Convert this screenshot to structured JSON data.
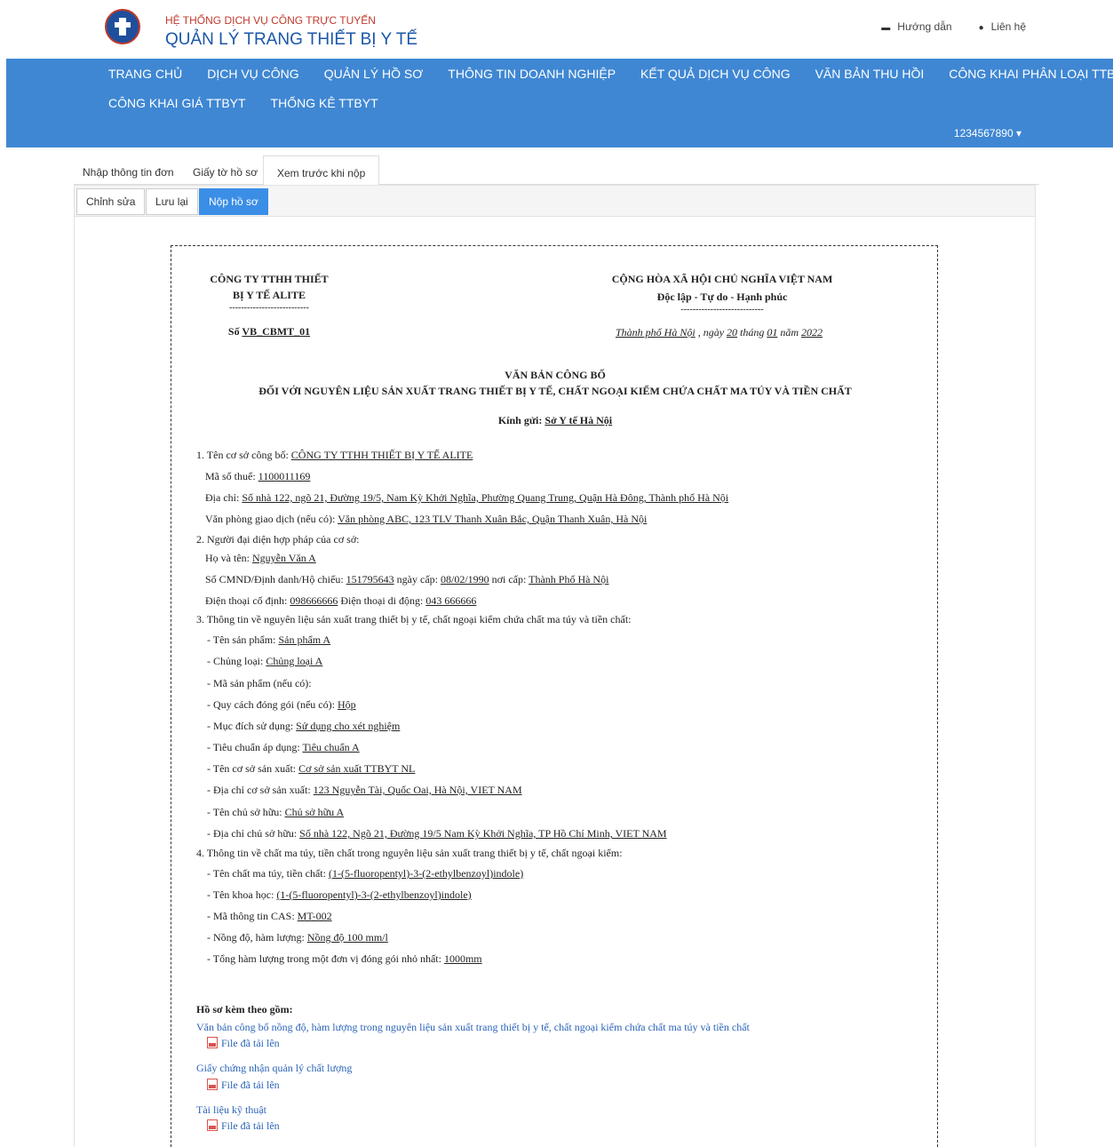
{
  "header": {
    "system": "HỆ THỐNG DỊCH VỤ CÔNG TRỰC TUYẾN",
    "title": "QUẢN LÝ TRANG THIẾT BỊ Y TẾ",
    "guide": "Hướng dẫn",
    "contact": "Liên hệ"
  },
  "nav": {
    "row1": [
      "TRANG CHỦ",
      "DỊCH VỤ CÔNG",
      "QUẢN LÝ HỒ SƠ",
      "THÔNG TIN DOANH NGHIỆP",
      "KẾT QUẢ DỊCH VỤ CÔNG",
      "VĂN BẢN THU HỒI",
      "CÔNG KHAI PHÂN LOẠI TTBYT"
    ],
    "row2": [
      "CÔNG KHAI GIÁ TTBYT",
      "THỐNG KÊ TTBYT"
    ],
    "user": "1234567890 ▾"
  },
  "tabs": [
    "Nhập thông tin đơn",
    "Giấy tờ hồ sơ",
    "Xem trước khi nộp"
  ],
  "toolbar": {
    "edit": "Chỉnh sửa",
    "save": "Lưu lại",
    "submit": "Nộp hồ sơ"
  },
  "doc": {
    "company1": "CÔNG TY TTHH THIẾT",
    "company2": "BỊ Y TẾ ALITE",
    "dash_left": "---------------------------",
    "number_prefix": "Số",
    "number": "VB_CBMT_01",
    "nation": "CỘNG HÒA XÃ HỘI CHỦ NGHĨA VIỆT NAM",
    "motto": "Độc lập - Tự do - Hạnh phúc",
    "dash_right": "----------------------------",
    "date_place": "Thành phố Hà Nội",
    "date_rest": " , ngày ",
    "day": "20",
    "month_label": " tháng ",
    "month": "01",
    "year_label": " năm ",
    "year": "2022",
    "title1": "VĂN BẢN CÔNG BỐ",
    "title2": "ĐỐI VỚI NGUYÊN LIỆU SẢN XUẤT TRANG THIẾT BỊ Y TẾ, CHẤT NGOẠI KIỂM CHỨA CHẤT MA TÚY VÀ TIỀN CHẤT",
    "kinh_gui_label": "Kính gửi: ",
    "kinh_gui": "Sở Y tế Hà Nội",
    "lines": [
      {
        "label": "1. Tên cơ sở công bố: ",
        "value": "CÔNG TY TTHH THIẾT BỊ Y TẾ ALITE",
        "indent": 0
      },
      {
        "label": "Mã số thuế: ",
        "value": "1100011169",
        "indent": 1
      },
      {
        "label": "Địa chỉ: ",
        "value": "Số nhà 122, ngõ 21, Đường 19/5, Nam Kỳ Khởi Nghĩa, Phường Quang Trung, Quận Hà Đông, Thành phố Hà Nội",
        "indent": 1
      },
      {
        "label": "Văn phòng giao dịch (nếu có): ",
        "value": "Văn phòng ABC, 123 TLV Thanh Xuân Bắc, Quận Thanh Xuân, Hà Nội",
        "indent": 1
      },
      {
        "label": "2. Người đại diện hợp pháp của cơ sở:",
        "value": "",
        "indent": 0
      },
      {
        "label": "Họ và tên: ",
        "value": "Nguyễn Văn A",
        "indent": 1
      },
      {
        "label": "Số CMND/Định danh/Hộ chiếu: ",
        "value": "151795643",
        "label2": "  ngày cấp: ",
        "value2": "08/02/1990",
        "label3": "  nơi cấp: ",
        "value3": "Thành Phố Hà Nội",
        "indent": 1
      },
      {
        "label": "Điện thoại cố định: ",
        "value": "098666666",
        "label2": "  Điện thoại di động: ",
        "value2": "043 666666",
        "indent": 1
      },
      {
        "label": "3. Thông tin về nguyên liệu sản xuất trang thiết bị y tế, chất ngoại kiểm chứa chất ma túy và tiền chất:",
        "value": "",
        "indent": 0
      },
      {
        "label": "- Tên sản phẩm: ",
        "value": "Sản phẩm A",
        "indent": 2
      },
      {
        "label": "- Chủng loại: ",
        "value": "Chủng loại A",
        "indent": 2
      },
      {
        "label": "- Mã sản phẩm (nếu có):",
        "value": "",
        "indent": 2
      },
      {
        "label": "- Quy cách đóng gói (nếu có): ",
        "value": "Hộp",
        "indent": 2
      },
      {
        "label": "- Mục đích sử dụng: ",
        "value": "Sử dụng cho xét nghiệm",
        "indent": 2
      },
      {
        "label": "- Tiêu chuẩn áp dụng: ",
        "value": "Tiêu chuẩn A",
        "indent": 2
      },
      {
        "label": "- Tên cơ sở sản xuất: ",
        "value": "Cơ sở sản xuất TTBYT NL",
        "indent": 2
      },
      {
        "label": "- Địa chỉ cơ sở sản xuất: ",
        "value": "123 Nguyễn Tài, Quốc Oai, Hà Nội, VIET NAM",
        "indent": 2
      },
      {
        "label": "- Tên chủ sở hữu: ",
        "value": "Chủ sở hữu A",
        "indent": 2
      },
      {
        "label": "- Địa chỉ chủ sở hữu: ",
        "value": "Số nhà 122, Ngõ 21, Đường 19/5 Nam Kỳ Khởi Nghĩa, TP Hồ Chí Minh, VIET NAM",
        "indent": 2
      },
      {
        "label": "4. Thông tin về chất ma túy, tiền chất trong nguyên liệu sản xuất trang thiết bị y tế, chất ngoại kiểm:",
        "value": "",
        "indent": 0
      },
      {
        "label": "- Tên chất ma túy, tiền chất: ",
        "value": "(1-(5-fluoropentyl)-3-(2-ethylbenzoyl)indole)",
        "indent": 2
      },
      {
        "label": "- Tên khoa học: ",
        "value": "(1-(5-fluoropentyl)-3-(2-ethylbenzoyl)indole)",
        "indent": 2
      },
      {
        "label": "- Mã thông tin CAS: ",
        "value": "MT-002",
        "indent": 2
      },
      {
        "label": "- Nồng độ, hàm lượng: ",
        "value": "Nồng độ 100 mm/l",
        "indent": 2
      },
      {
        "label": "- Tổng hàm lượng trong một đơn vị đóng gói nhỏ nhất: ",
        "value": "1000mm",
        "indent": 2
      }
    ],
    "attach_title": "Hồ sơ kèm theo gồm:",
    "attachments": [
      {
        "name": "Văn bản công bố nồng độ, hàm lượng trong nguyên liệu sản xuất trang thiết bị y tế, chất ngoại kiểm chứa chất ma túy và tiền chất",
        "file": "File đã tải lên"
      },
      {
        "name": "Giấy chứng nhận quản lý chất lượng",
        "file": "File đã tải lên"
      },
      {
        "name": "Tài liệu kỹ thuật",
        "file": "File đã tải lên"
      }
    ]
  }
}
